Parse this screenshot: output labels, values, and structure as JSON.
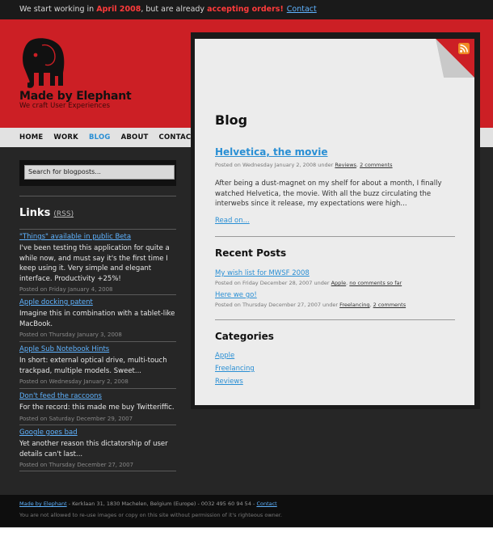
{
  "topbar": {
    "part1": "We start working in ",
    "highlight1": "April 2008",
    "part2": ", but are already ",
    "highlight2": "accepting orders!",
    "contact": "Contact"
  },
  "brand": {
    "name": "Made by Elephant",
    "tagline": "We craft User Experiences"
  },
  "nav": {
    "items": [
      "HOME",
      "WORK",
      "BLOG",
      "ABOUT",
      "CONTACT"
    ],
    "active": "BLOG"
  },
  "sidebar": {
    "search_placeholder": "Search for blogposts...",
    "links_title": "Links",
    "links_rss": "(RSS)",
    "links": [
      {
        "title": "\"Things\" available in public Beta",
        "desc": "I've been testing this application for quite a while now, and must say it's the first time I keep using it. Very simple and elegant interface. Productivity +25%!",
        "posted": "Posted on Friday January 4, 2008"
      },
      {
        "title": "Apple docking patent",
        "desc": "Imagine this in combination with a tablet-like MacBook.",
        "posted": "Posted on Thursday January 3, 2008"
      },
      {
        "title": "Apple Sub Notebook Hints",
        "desc": "In short: external optical drive, multi-touch trackpad, multiple models. Sweet...",
        "posted": "Posted on Wednesday January 2, 2008"
      },
      {
        "title": "Don't feed the raccoons",
        "desc": "For the record: this made me buy Twitteriffic.",
        "posted": "Posted on Saturday December 29, 2007"
      },
      {
        "title": "Google goes bad",
        "desc": "Yet another reason this dictatorship of user details can't last...",
        "posted": "Posted on Thursday December 27, 2007"
      }
    ]
  },
  "main": {
    "title": "Blog",
    "post": {
      "title": "Helvetica, the movie",
      "meta_prefix": "Posted on Wednesday January 2, 2008 under ",
      "category": "Reviews",
      "separator": ",",
      "comments": "2 comments",
      "body": "After being a dust-magnet on my shelf for about a month, I finally watched Helvetica, the movie. With all the buzz circulating the interwebs since it release, my expectations were high...",
      "read_on": "Read on..."
    },
    "recent_title": "Recent Posts",
    "recent": [
      {
        "title": "My wish list for MWSF 2008",
        "meta_prefix": "Posted on Friday December 28, 2007 under ",
        "category": "Apple",
        "comments": "no comments so far"
      },
      {
        "title": "Here we go!",
        "meta_prefix": "Posted on Thursday December 27, 2007 under ",
        "category": "Freelancing",
        "comments": "2 comments"
      }
    ],
    "categories_title": "Categories",
    "categories": [
      "Apple",
      "Freelancing",
      "Reviews"
    ]
  },
  "footer": {
    "company": "Made by Elephant",
    "address": " - Kerklaan 31, 1830 Machelen, Belgium (Europe) - 0032 495 60 94 54 - ",
    "contact": "Contact",
    "notice": "You are not allowed to re-use images or copy on this site without permission of it's righteous owner."
  },
  "colors": {
    "brand_red": "#cc1f25",
    "link_blue": "#2a8fd4",
    "dark_bg": "#262626"
  },
  "icons": [
    "elephant-logo-icon",
    "rss-feed-icon",
    "page-curl-icon"
  ]
}
